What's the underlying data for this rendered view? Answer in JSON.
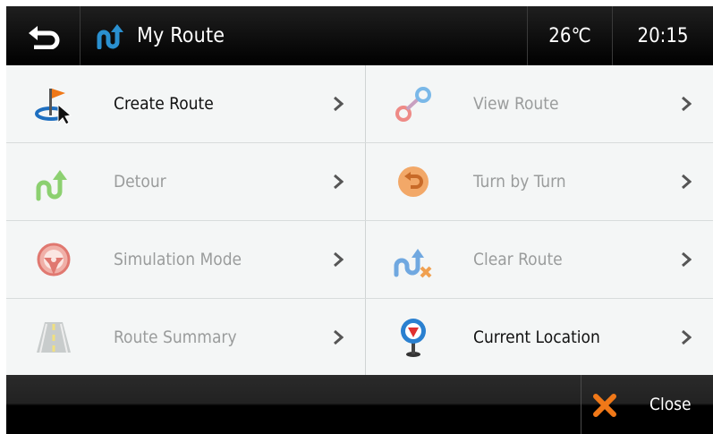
{
  "header": {
    "title": "My Route",
    "temperature": "26℃",
    "time": "20:15"
  },
  "menu": {
    "create_route": "Create Route",
    "view_route": "View Route",
    "detour": "Detour",
    "turn_by_turn": "Turn by Turn",
    "simulation_mode": "Simulation Mode",
    "clear_route": "Clear Route",
    "route_summary": "Route Summary",
    "current_location": "Current Location"
  },
  "footer": {
    "close_label": "Close"
  },
  "colors": {
    "header_bg": "#000000",
    "menu_bg": "#f4f6f6",
    "enabled_text": "#111111",
    "disabled_text": "#9a9c9c",
    "accent_blue": "#1e88c8",
    "close_orange": "#f07818"
  }
}
